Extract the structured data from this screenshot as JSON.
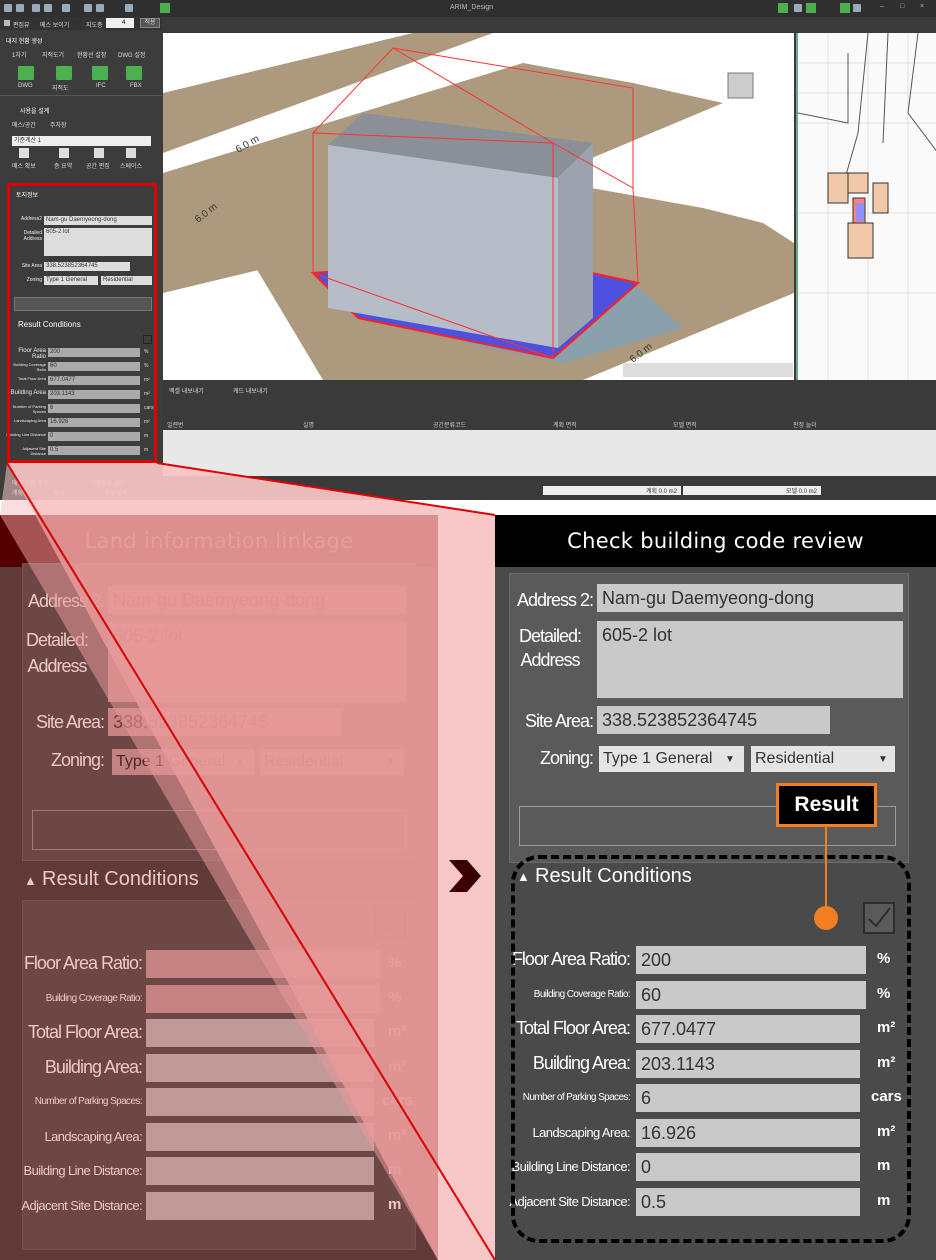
{
  "app": {
    "title": "ARIM_Design",
    "mode_btn1": "편집뷰",
    "mode_btn2": "메스 보이기",
    "floor_label": "지도층",
    "floor_value": "4",
    "apply_btn": "적용"
  },
  "leftpanel": {
    "section1_title": "대지 현황 생성",
    "tabs": [
      "1차기",
      "지적도기",
      "현황선 설정",
      "DWG 설정"
    ],
    "file_buttons": [
      "DWG",
      "지적도",
      "IFC",
      "FBX"
    ],
    "section2_title": "사용을 설계",
    "subtabs": [
      "매스/공간",
      "주차장"
    ],
    "dropdown_value": "기준계산 1",
    "tool_buttons": [
      "매스 확보",
      "층 요약",
      "공간 편집",
      "스페이스"
    ],
    "land_title": "토지정보",
    "address2_label": "Address2",
    "address2_value": "Nam-gu Daemyeong-dong",
    "detailed_label": "Detailed Address",
    "detailed_value": "605-2 lot",
    "site_area_label": "Site Area",
    "site_area_value": "338.523852364745",
    "zoning_label": "Zoning",
    "zoning1": "Type 1 General",
    "zoning2": "Residential",
    "result_title": "Result Conditions",
    "rows": [
      {
        "label": "Floor Area Ratio",
        "value": "200",
        "unit": "%"
      },
      {
        "label": "Building Coverage Ratio",
        "value": "60",
        "unit": "%"
      },
      {
        "label": "Total Floor Area",
        "value": "677.0477",
        "unit": "m²"
      },
      {
        "label": "Building Area",
        "value": "203.1143",
        "unit": "m²"
      },
      {
        "label": "Number of Parking Spaces",
        "value": "6",
        "unit": "cars"
      },
      {
        "label": "Landscaping Area",
        "value": "16.926",
        "unit": "m²"
      },
      {
        "label": "Building Line Distance",
        "value": "0",
        "unit": "m"
      },
      {
        "label": "Adjacent Site Distance",
        "value": "0.5",
        "unit": "m"
      }
    ],
    "footer_items": [
      "매스 관련 추천",
      "건축법규 GPT",
      "계획",
      "속성",
      "계산 검토"
    ]
  },
  "viewport": {
    "road_labels": [
      "6.0 m",
      "6.0 m",
      "6.0 m"
    ]
  },
  "bottompanel": {
    "tab1": "엑셀 내보내기",
    "tab2": "캐드 내보내기",
    "columns": [
      "일련번",
      "실명",
      "공간분류코드",
      "계획 면적",
      "모델 면적",
      "판정 늘이"
    ],
    "status1": "계획 0.0 m2",
    "status2": "모델 0.0 m2"
  },
  "left_zoom": {
    "title": "Land information linkage",
    "address2_label": "Address 2:",
    "address2_value": "Nam-gu Daemyeong-dong",
    "detailed_label": "Detailed:\nAddress",
    "detailed_value": "605-2 lot",
    "site_area_label": "Site Area:",
    "site_area_value": "338.523852364745",
    "zoning_label": "Zoning:",
    "zoning1": "Type 1 General",
    "zoning2": "Residential",
    "result_title": "Result Conditions",
    "rows": [
      {
        "label": "Floor Area Ratio:",
        "unit": "%"
      },
      {
        "label": "Building Coverage Ratio:",
        "unit": "%"
      },
      {
        "label": "Total Floor Area:",
        "unit": "m²"
      },
      {
        "label": "Building Area:",
        "unit": "m²"
      },
      {
        "label": "Number of Parking Spaces:",
        "unit": "cars"
      },
      {
        "label": "Landscaping Area:",
        "unit": "m²"
      },
      {
        "label": "Building Line Distance:",
        "unit": "m"
      },
      {
        "label": "Adjacent Site Distance:",
        "unit": "m"
      }
    ]
  },
  "right_zoom": {
    "title": "Check building code review",
    "address2_label": "Address 2:",
    "address2_value": "Nam-gu Daemyeong-dong",
    "detailed_label": "Detailed:\nAddress",
    "detailed_value": "605-2 lot",
    "site_area_label": "Site Area:",
    "site_area_value": "338.523852364745",
    "zoning_label": "Zoning:",
    "zoning1": "Type 1 General",
    "zoning2": "Residential",
    "result_title": "Result Conditions",
    "result_callout": "Result",
    "rows": [
      {
        "label": "Floor Area Ratio:",
        "value": "200",
        "unit": "%"
      },
      {
        "label": "Building Coverage Ratio:",
        "value": "60",
        "unit": "%"
      },
      {
        "label": "Total Floor Area:",
        "value": "677.0477",
        "unit": "m²"
      },
      {
        "label": "Building Area:",
        "value": "203.1143",
        "unit": "m²"
      },
      {
        "label": "Number of Parking Spaces:",
        "value": "6",
        "unit": "cars"
      },
      {
        "label": "Landscaping Area:",
        "value": "16.926",
        "unit": "m²"
      },
      {
        "label": "Building Line Distance:",
        "value": "0",
        "unit": "m"
      },
      {
        "label": "Adjacent Site Distance:",
        "value": "0.5",
        "unit": "m"
      }
    ]
  },
  "colors": {
    "highlight_red": "#e00000",
    "callout_orange": "#f47e22",
    "panel_dark": "#4a4a4a",
    "accent_green": "#4caf50"
  }
}
